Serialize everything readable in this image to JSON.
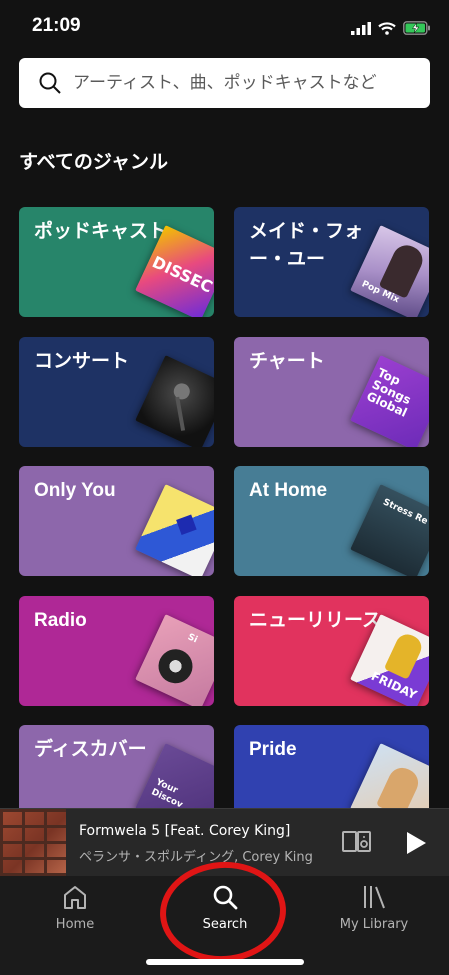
{
  "status_bar": {
    "time": "21:09"
  },
  "search": {
    "placeholder": "アーティスト、曲、ポッドキャストなど"
  },
  "section_title": "すべてのジャンル",
  "genres": [
    {
      "label": "ポッドキャスト",
      "color": "#27856a",
      "art_text": "DISSEC"
    },
    {
      "label": "メイド・フォー・ユー",
      "color": "#1e3264",
      "art_text": "Pop Mix"
    },
    {
      "label": "コンサート",
      "color": "#1e3264",
      "art_text": ""
    },
    {
      "label": "チャート",
      "color": "#8d67ab",
      "art_text": "Top Songs Global"
    },
    {
      "label": "Only You",
      "color": "#8d67ab",
      "art_text": ""
    },
    {
      "label": "At Home",
      "color": "#477d95",
      "art_text": "Stress Re"
    },
    {
      "label": "Radio",
      "color": "#af2896",
      "art_text": "Si"
    },
    {
      "label": "ニューリリース",
      "color": "#e1335e",
      "art_text": "FRIDAY"
    },
    {
      "label": "ディスカバー",
      "color": "#8d67ab",
      "art_text": "Your Discov"
    },
    {
      "label": "Pride",
      "color": "#3041b0",
      "art_text": ""
    }
  ],
  "now_playing": {
    "title": "Formwela 5 [Feat. Corey King]",
    "artist": "ペランサ・スポルディング, Corey King"
  },
  "tabs": [
    {
      "label": "Home",
      "icon": "home-icon",
      "active": false
    },
    {
      "label": "Search",
      "icon": "search-icon",
      "active": true
    },
    {
      "label": "My Library",
      "icon": "library-icon",
      "active": false
    }
  ],
  "colors": {
    "background": "#121212",
    "annotation": "#e01515"
  }
}
